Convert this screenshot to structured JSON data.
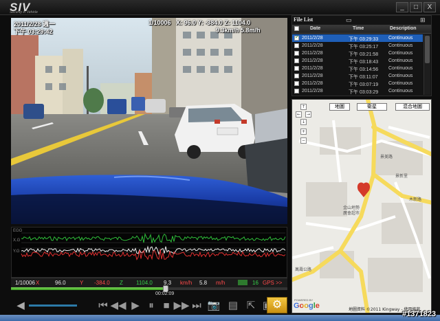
{
  "app": {
    "logo": "SIV",
    "logo_sub": "Security in Vehicle"
  },
  "window_buttons": [
    "_",
    "□",
    "X"
  ],
  "video": {
    "datetime": "2011/2/28 週一",
    "time": "下午 03:29:42",
    "counter": "1/10006",
    "sensor_line": "X: 96.0 Y: -384.0 Z: 1104.0",
    "speed_line": "9.3km/h 5.8m/h"
  },
  "graph": {
    "axis_labels": [
      "EGG",
      "X.G",
      "Y.G"
    ]
  },
  "readout": {
    "counter": "1/10006",
    "x_label": "X",
    "x_value": "96.0",
    "y_label": "Y",
    "y_value": "-384.0",
    "z_label": "Z",
    "z_value": "1104.0",
    "kmh_value": "9.3",
    "kmh_unit": "km/h",
    "mh_value": "5.8",
    "mh_unit": "m/h",
    "sat_count": "16",
    "gps_label": "GPS >>"
  },
  "timeline": {
    "time": "00:02:09",
    "progress": 0.56
  },
  "file_list": {
    "title": "File List",
    "columns": [
      "Date",
      "Time",
      "Description"
    ],
    "rows": [
      {
        "date": "2011/2/28",
        "time": "下午 03:29:33",
        "desc": "Continuous",
        "checked": true,
        "selected": true
      },
      {
        "date": "2011/2/28",
        "time": "下午 03:25:17",
        "desc": "Continuous",
        "checked": false,
        "selected": false
      },
      {
        "date": "2011/2/28",
        "time": "下午 03:21:58",
        "desc": "Continuous",
        "checked": false,
        "selected": false
      },
      {
        "date": "2011/2/28",
        "time": "下午 03:18:43",
        "desc": "Continuous",
        "checked": false,
        "selected": false
      },
      {
        "date": "2011/2/28",
        "time": "下午 03:14:56",
        "desc": "Continuous",
        "checked": false,
        "selected": false
      },
      {
        "date": "2011/2/28",
        "time": "下午 03:11:07",
        "desc": "Continuous",
        "checked": false,
        "selected": false
      },
      {
        "date": "2011/2/28",
        "time": "下午 03:07:19",
        "desc": "Continuous",
        "checked": false,
        "selected": false
      },
      {
        "date": "2011/2/28",
        "time": "下午 03:03:29",
        "desc": "Continuous",
        "checked": false,
        "selected": false
      }
    ]
  },
  "map": {
    "view_buttons": [
      "地圖",
      "衛星",
      "混合地圖"
    ],
    "labels": [
      "金山地勢",
      "廣會超市",
      "萬壽公路",
      "景美路",
      "景新里",
      "木新路"
    ],
    "powered_by": "POWERED BY",
    "google": "Google",
    "copyright": "地圖資料 ©2011 Kingway - 使用條款"
  },
  "watermark": "#1371823"
}
